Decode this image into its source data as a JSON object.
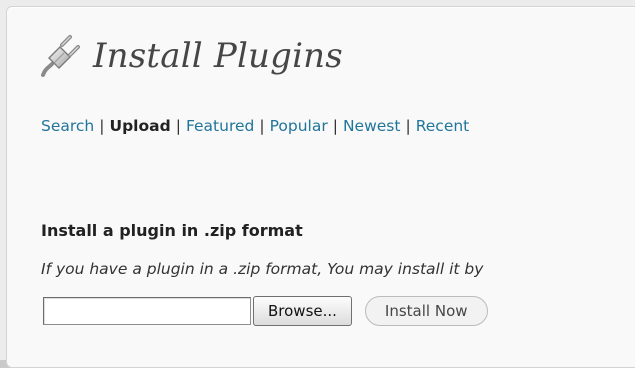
{
  "page": {
    "title": "Install Plugins",
    "icon": "plugin-icon"
  },
  "tabs": [
    {
      "label": "Search",
      "current": false
    },
    {
      "label": "Upload",
      "current": true
    },
    {
      "label": "Featured",
      "current": false
    },
    {
      "label": "Popular",
      "current": false
    },
    {
      "label": "Newest",
      "current": false
    },
    {
      "label": "Recent",
      "current": false
    }
  ],
  "tab_separator": "|",
  "upload": {
    "heading": "Install a plugin in .zip format",
    "description": "If you have a plugin in a .zip format, You may install it by",
    "file_value": "",
    "browse_label": "Browse...",
    "install_label": "Install Now"
  },
  "colors": {
    "link": "#21759b",
    "title": "#464646",
    "panel_bg": "#f9f9f9"
  }
}
